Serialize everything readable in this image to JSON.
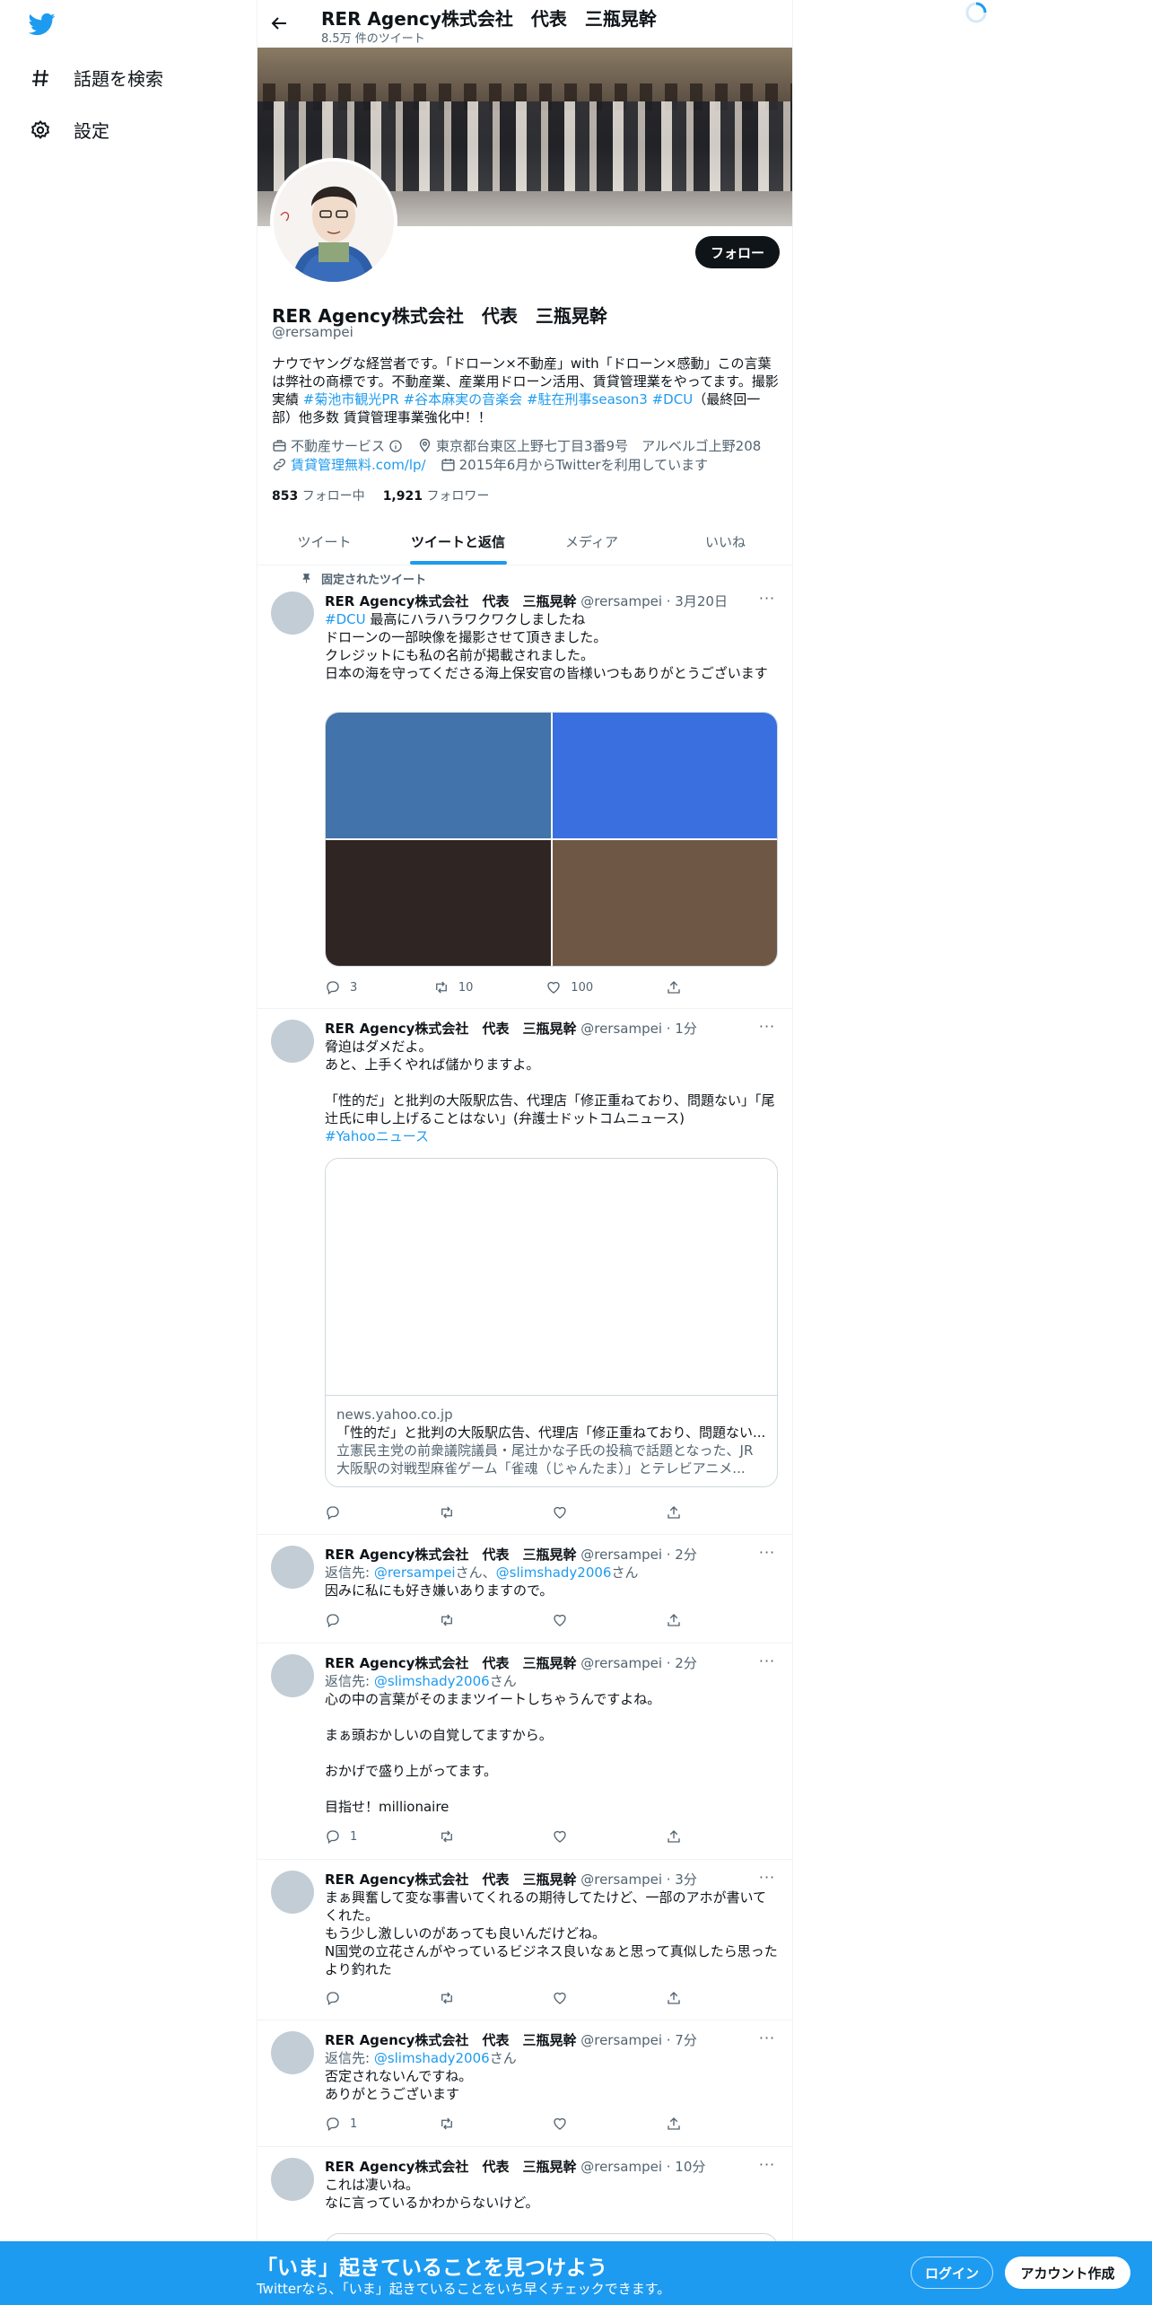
{
  "nav": {
    "explore_label": "話題を検索",
    "settings_label": "設定"
  },
  "header": {
    "name": "RER Agency株式会社　代表　三瓶晃幹",
    "tweet_count": "8.5万 件のツイート"
  },
  "profile": {
    "follow_label": "フォロー",
    "name": "RER Agency株式会社　代表　三瓶晃幹",
    "handle": "@rersampei",
    "bio_part1": "ナウでヤングな経営者です。「ドローン×不動産」with「ドローン×感動」この言葉は弊社の商標です。不動産業、産業用ドローン活用、賃貸管理業をやってます。撮影実績 ",
    "bio_tag1": "#菊池市観光PR",
    "bio_tag2": "#谷本麻実の音楽会",
    "bio_tag3": "#駐在刑事season3",
    "bio_tag4": "#DCU",
    "bio_part2": "（最終回一部）他多数 賃貸管理事業強化中！！",
    "category": "不動産サービス",
    "location": "東京都台東区上野七丁目3番9号　アルベルゴ上野208",
    "website": "賃貸管理無料.com/lp/",
    "joined": "2015年6月からTwitterを利用しています",
    "following_count": "853",
    "following_label": "フォロー中",
    "followers_count": "1,921",
    "followers_label": "フォロワー"
  },
  "tabs": [
    {
      "label": "ツイート"
    },
    {
      "label": "ツイートと返信"
    },
    {
      "label": "メディア"
    },
    {
      "label": "いいね"
    }
  ],
  "active_tab": "ツイートと返信",
  "pinned_label": "固定されたツイート",
  "tweets": [
    {
      "name": "RER Agency株式会社　代表　三瓶晃幹",
      "meta": "@rersampei · 3月20日",
      "tag": "#DCU",
      "text_after_tag": " 最高にハラハラワクワクしましたね",
      "text": "ドローンの一部映像を撮影させて頂きました。\nクレジットにも私の名前が掲載されました。\n日本の海を守ってくださる海上保安官の皆様いつもありがとうございます",
      "replies": "3",
      "retweets": "10",
      "likes": "100",
      "media_colors": [
        "#4273aa",
        "#3a6fe0",
        "#2f2522",
        "#6f5745"
      ]
    },
    {
      "name": "RER Agency株式会社　代表　三瓶晃幹",
      "meta": "@rersampei · 1分",
      "text": "脅迫はダメだよ。\nあと、上手くやれば儲かりますよ。\n\n「性的だ」と批判の大阪駅広告、代理店「修正重ねており、問題ない」「尾辻氏に申し上げることはない」(弁護士ドットコムニュース)",
      "tag": "#Yahooニュース",
      "card_domain": "news.yahoo.co.jp",
      "card_title": "「性的だ」と批判の大阪駅広告、代理店「修正重ねており、問題ない...",
      "card_desc1": "立憲民主党の前衆議院議員・尾辻かな子氏の投稿で話題となった、JR",
      "card_desc2": "大阪駅の対戦型麻雀ゲーム「雀魂（じゃんたま）」とテレビアニメ..."
    },
    {
      "name": "RER Agency株式会社　代表　三瓶晃幹",
      "meta": "@rersampei · 2分",
      "reply_prefix": "返信先: ",
      "reply_user1": "@rersampei",
      "reply_mid": "さん、",
      "reply_user2": "@slimshady2006",
      "reply_suffix": "さん",
      "text": "因みに私にも好き嫌いありますので。"
    },
    {
      "name": "RER Agency株式会社　代表　三瓶晃幹",
      "meta": "@rersampei · 2分",
      "reply_prefix": "返信先: ",
      "reply_user1": "@slimshady2006",
      "reply_suffix": "さん",
      "text": "心の中の言葉がそのままツイートしちゃうんですよね。\n\nまぁ頭おかしいの自覚してますから。\n\nおかげで盛り上がってます。\n\n目指せ！millionaire",
      "replies": "1"
    },
    {
      "name": "RER Agency株式会社　代表　三瓶晃幹",
      "meta": "@rersampei · 3分",
      "text": "まぁ興奮して変な事書いてくれるの期待してたけど、一部のアホが書いてくれた。\nもう少し激しいのがあっても良いんだけどね。\nN国党の立花さんがやっているビジネス良いなぁと思って真似したら思ったより釣れた"
    },
    {
      "name": "RER Agency株式会社　代表　三瓶晃幹",
      "meta": "@rersampei · 7分",
      "reply_prefix": "返信先: ",
      "reply_user1": "@slimshady2006",
      "reply_suffix": "さん",
      "text": "否定されないんですね。\nありがとうございます",
      "replies": "1"
    },
    {
      "name": "RER Agency株式会社　代表　三瓶晃幹",
      "meta": "@rersampei · 10分",
      "text": "これは凄いね。\nなに言っているかわからないけど。"
    }
  ],
  "bottom_bar": {
    "title": "「いま」起きていることを見つけよう",
    "subtitle": "Twitterなら、「いま」起きていることをいち早くチェックできます。",
    "login_label": "ログイン",
    "signup_label": "アカウント作成"
  },
  "colors": {
    "accent": "#1d9bf0",
    "text": "#0f1419",
    "muted": "#536471"
  }
}
